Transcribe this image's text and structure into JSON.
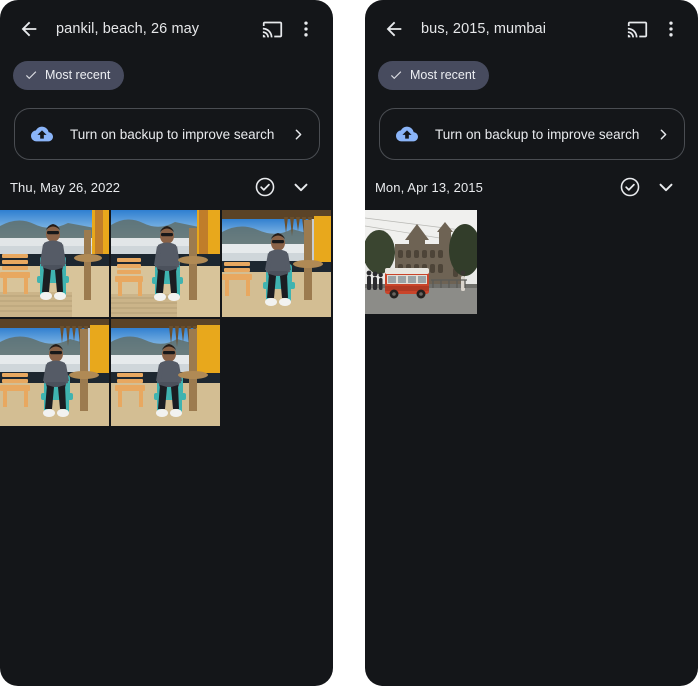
{
  "app": {
    "background_color": "#141619",
    "accent_blue": "#8ab4f8",
    "chip_color": "#474b5e",
    "text_color": "#e8eaed"
  },
  "panels": [
    {
      "appbar": {
        "back_label": "Back",
        "query": "pankil, beach, 26 may",
        "cast_label": "Cast",
        "more_label": "More options"
      },
      "chip": {
        "label": "Most recent",
        "checked": true
      },
      "banner": {
        "icon": "cloud-upload-icon",
        "label": "Turn on backup to improve search",
        "chevron": "chevron-right-icon"
      },
      "date_header": {
        "label": "Thu, May 26, 2022",
        "select_label": "Select all",
        "collapse_label": "Collapse"
      },
      "photos": [
        {
          "alt": "Man seated on teal chair at beach resort, wooden deck",
          "scene": "beach-wide"
        },
        {
          "alt": "Man seated on teal chair at beach resort, palm pillar",
          "scene": "beach-wide"
        },
        {
          "alt": "Man seated on teal chair beside orange chair, thatched roof",
          "scene": "beach-thatch"
        },
        {
          "alt": "Man seated on teal chair beside orange chair, thatched roof",
          "scene": "beach-thatch"
        },
        {
          "alt": "Man seated on teal chair beside orange chair, beach view",
          "scene": "beach-thatch"
        }
      ]
    },
    {
      "appbar": {
        "back_label": "Back",
        "query": "bus, 2015, mumbai",
        "cast_label": "Cast",
        "more_label": "More options"
      },
      "chip": {
        "label": "Most recent",
        "checked": true
      },
      "banner": {
        "icon": "cloud-upload-icon",
        "label": "Turn on backup to improve search",
        "chevron": "chevron-right-icon"
      },
      "date_header": {
        "label": "Mon, Apr 13, 2015",
        "select_label": "Select all",
        "collapse_label": "Collapse"
      },
      "photos": [
        {
          "alt": "Red BEST bus in front of Victorian heritage building, Mumbai street",
          "scene": "mumbai-bus"
        }
      ]
    }
  ]
}
